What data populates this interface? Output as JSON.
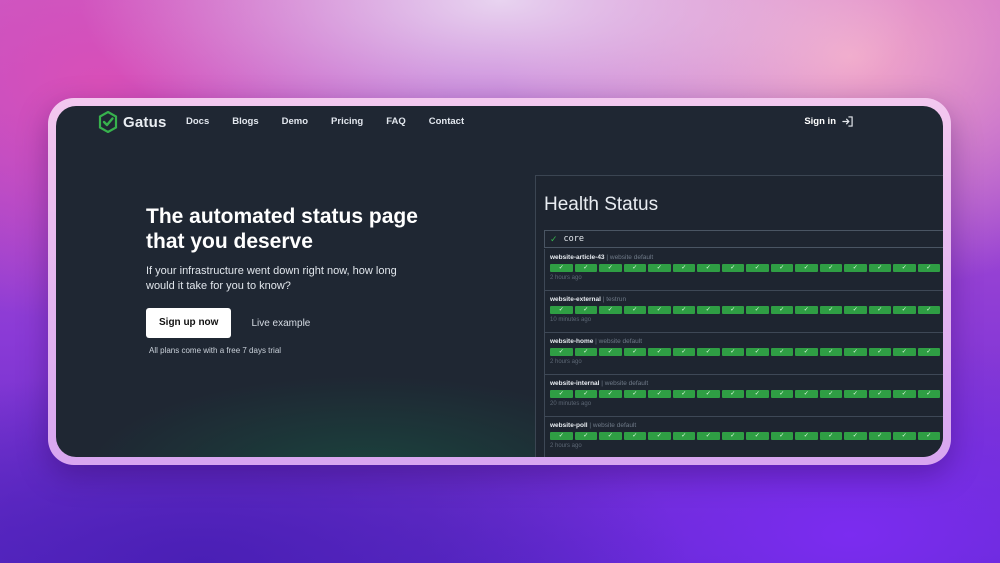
{
  "nav": {
    "brand": "Gatus",
    "links": [
      "Docs",
      "Blogs",
      "Demo",
      "Pricing",
      "FAQ",
      "Contact"
    ],
    "signin": "Sign in"
  },
  "hero": {
    "title": "The automated status page that you deserve",
    "subtitle": "If your infrastructure went down right now, how long would it take for you to know?",
    "signup_label": "Sign up now",
    "live_label": "Live example",
    "trial_note": "All plans come with a free 7 days trial"
  },
  "health": {
    "title": "Health Status",
    "group_name": "core",
    "services": [
      {
        "name": "website-article-43",
        "group": "website default",
        "time": "2 hours ago",
        "checks": 16
      },
      {
        "name": "website-external",
        "group": "testrun",
        "time": "10 minutes ago",
        "checks": 16
      },
      {
        "name": "website-home",
        "group": "website default",
        "time": "2 hours ago",
        "checks": 16
      },
      {
        "name": "website-internal",
        "group": "website default",
        "time": "20 minutes ago",
        "checks": 16
      },
      {
        "name": "website-poll",
        "group": "website default",
        "time": "2 hours ago",
        "checks": 16
      }
    ]
  },
  "colors": {
    "accent": "#2f9e44",
    "background": "#1f2733"
  },
  "icons": {
    "logo": "gatus-logo-icon",
    "signin": "signin-arrow-icon",
    "check": "check-icon"
  }
}
